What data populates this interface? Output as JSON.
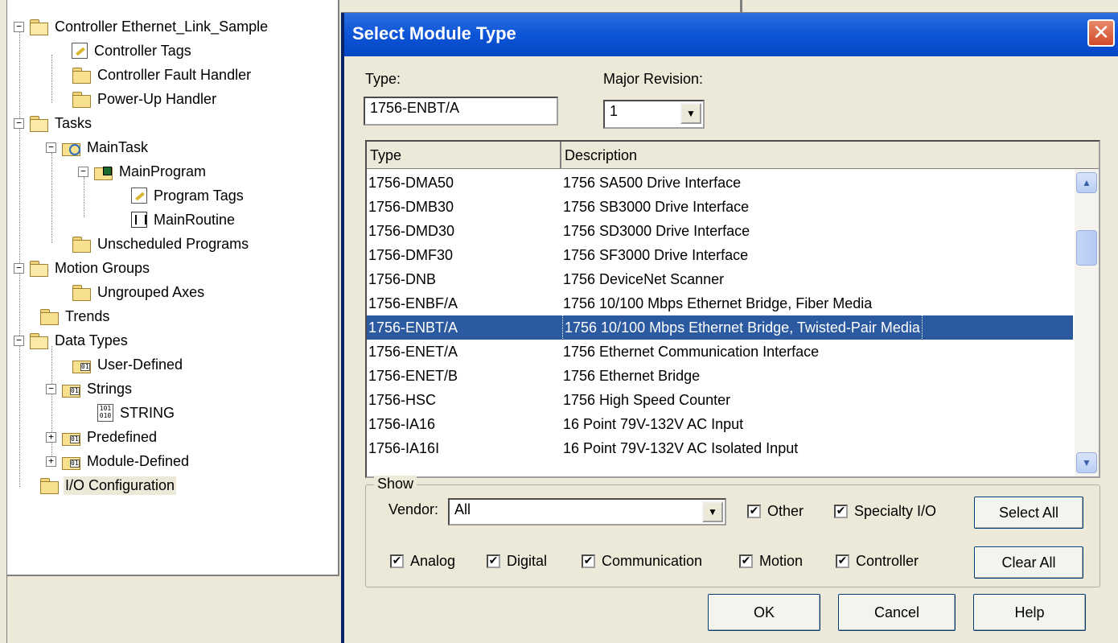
{
  "tree": {
    "items": [
      {
        "label": "Controller Ethernet_Link_Sample",
        "indent": 0,
        "icon": "folder-open-icon",
        "expander": "−"
      },
      {
        "label": "Controller Tags",
        "indent": 1,
        "icon": "tags-icon"
      },
      {
        "label": "Controller Fault Handler",
        "indent": 1,
        "icon": "folder-icon"
      },
      {
        "label": "Power-Up Handler",
        "indent": 1,
        "icon": "folder-icon"
      },
      {
        "label": "Tasks",
        "indent": 0,
        "icon": "folder-open-icon",
        "expander": "−"
      },
      {
        "label": "MainTask",
        "indent": 1,
        "icon": "task-icon",
        "expander": "−"
      },
      {
        "label": "MainProgram",
        "indent": 2,
        "icon": "program-icon",
        "expander": "−"
      },
      {
        "label": "Program Tags",
        "indent": 3,
        "icon": "tags-icon"
      },
      {
        "label": "MainRoutine",
        "indent": 3,
        "icon": "routine-icon"
      },
      {
        "label": "Unscheduled Programs",
        "indent": 1,
        "icon": "folder-icon"
      },
      {
        "label": "Motion Groups",
        "indent": 0,
        "icon": "folder-open-icon",
        "expander": "−"
      },
      {
        "label": "Ungrouped Axes",
        "indent": 1,
        "icon": "folder-icon"
      },
      {
        "label": "Trends",
        "indent": 0,
        "icon": "folder-icon"
      },
      {
        "label": "Data Types",
        "indent": 0,
        "icon": "folder-open-icon",
        "expander": "−"
      },
      {
        "label": "User-Defined",
        "indent": 1,
        "icon": "datatype-icon"
      },
      {
        "label": "Strings",
        "indent": 1,
        "icon": "datatype-icon",
        "expander": "−"
      },
      {
        "label": "STRING",
        "indent": 2,
        "icon": "string-icon"
      },
      {
        "label": "Predefined",
        "indent": 1,
        "icon": "datatype-icon",
        "expander": "+"
      },
      {
        "label": "Module-Defined",
        "indent": 1,
        "icon": "datatype-icon",
        "expander": "+"
      },
      {
        "label": "I/O Configuration",
        "indent": 0,
        "icon": "folder-icon",
        "selected": true
      }
    ]
  },
  "dialog": {
    "title": "Select Module Type",
    "close_label": "✕",
    "type_label": "Type:",
    "type_value": "1756-ENBT/A",
    "major_revision_label": "Major Revision:",
    "major_revision_value": "1",
    "list": {
      "headers": [
        "Type",
        "Description"
      ],
      "rows": [
        {
          "type": "1756-DMA50",
          "desc": "1756 SA500 Drive Interface"
        },
        {
          "type": "1756-DMB30",
          "desc": "1756 SB3000 Drive Interface"
        },
        {
          "type": "1756-DMD30",
          "desc": "1756 SD3000 Drive Interface"
        },
        {
          "type": "1756-DMF30",
          "desc": "1756 SF3000 Drive Interface"
        },
        {
          "type": "1756-DNB",
          "desc": "1756 DeviceNet Scanner"
        },
        {
          "type": "1756-ENBF/A",
          "desc": "1756 10/100 Mbps Ethernet Bridge, Fiber Media"
        },
        {
          "type": "1756-ENBT/A",
          "desc": "1756 10/100 Mbps Ethernet Bridge, Twisted-Pair Media",
          "selected": true
        },
        {
          "type": "1756-ENET/A",
          "desc": "1756 Ethernet Communication Interface"
        },
        {
          "type": "1756-ENET/B",
          "desc": "1756 Ethernet Bridge"
        },
        {
          "type": "1756-HSC",
          "desc": "1756 High Speed Counter"
        },
        {
          "type": "1756-IA16",
          "desc": "16 Point 79V-132V AC Input"
        },
        {
          "type": "1756-IA16I",
          "desc": "16 Point 79V-132V AC Isolated Input"
        }
      ]
    },
    "show": {
      "legend": "Show",
      "vendor_label": "Vendor:",
      "vendor_value": "All",
      "checkboxes": {
        "other": "Other",
        "specialty": "Specialty I/O",
        "analog": "Analog",
        "digital": "Digital",
        "communication": "Communication",
        "motion": "Motion",
        "controller": "Controller"
      },
      "check_mark": "✔",
      "select_all": "Select All",
      "clear_all": "Clear All"
    },
    "buttons": {
      "ok": "OK",
      "cancel": "Cancel",
      "help": "Help"
    }
  }
}
